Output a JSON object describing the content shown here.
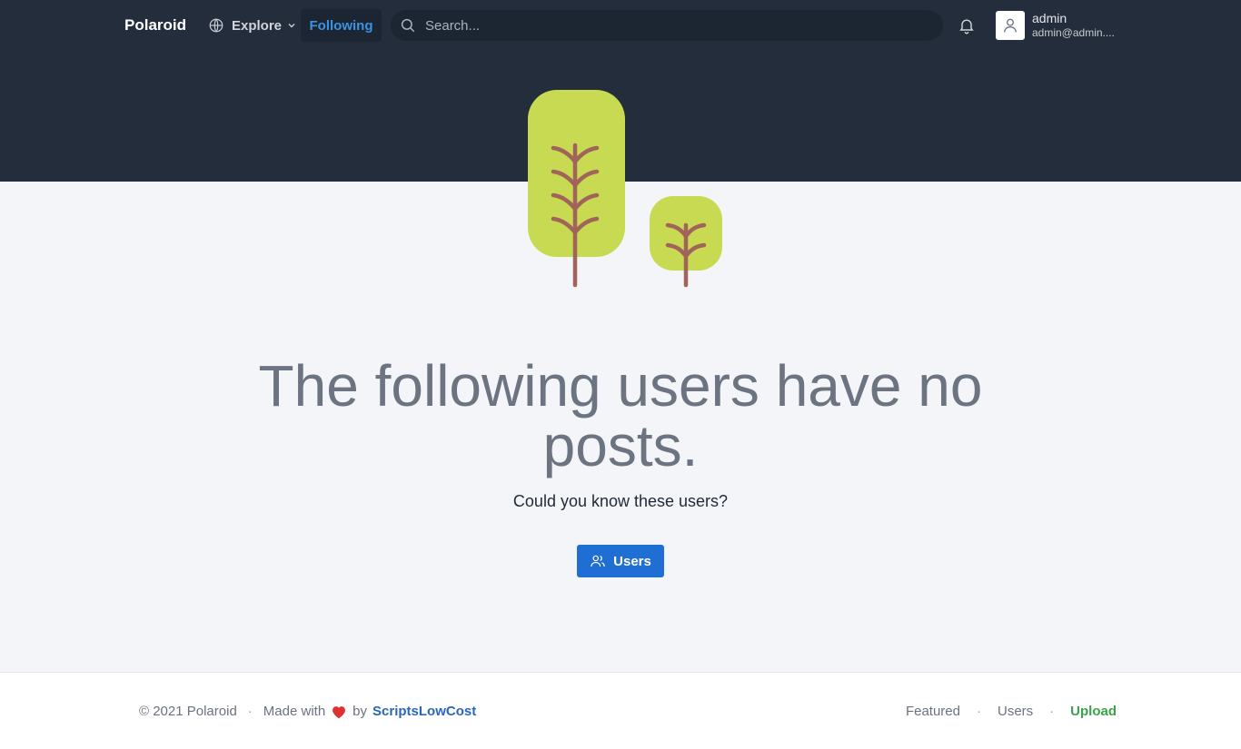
{
  "navbar": {
    "brand": "Polaroid",
    "explore_label": "Explore",
    "following_label": "Following",
    "search_placeholder": "Search...",
    "user": {
      "name": "admin",
      "email": "admin@admin...."
    }
  },
  "main": {
    "headline": "The following users have no posts.",
    "subtext": "Could you know these users?",
    "users_button_label": "Users"
  },
  "footer": {
    "copyright": "© 2021 Polaroid",
    "made_with": "Made with",
    "by": "by",
    "author": "ScriptsLowCost",
    "links": {
      "featured": "Featured",
      "users": "Users",
      "upload": "Upload"
    }
  },
  "colors": {
    "header_bg": "#232d3b",
    "accent_blue": "#1f6ed4",
    "following_active": "#3b92e3",
    "upload_green": "#3aa34a",
    "tree_leaf": "#c8da52",
    "tree_trunk": "#a0645a",
    "heart": "#e03131"
  },
  "icons": {
    "explore": "globe-icon",
    "search": "search-icon",
    "notifications": "bell-icon",
    "avatar": "user-icon",
    "users_button": "users-icon",
    "heart": "heart-icon"
  }
}
